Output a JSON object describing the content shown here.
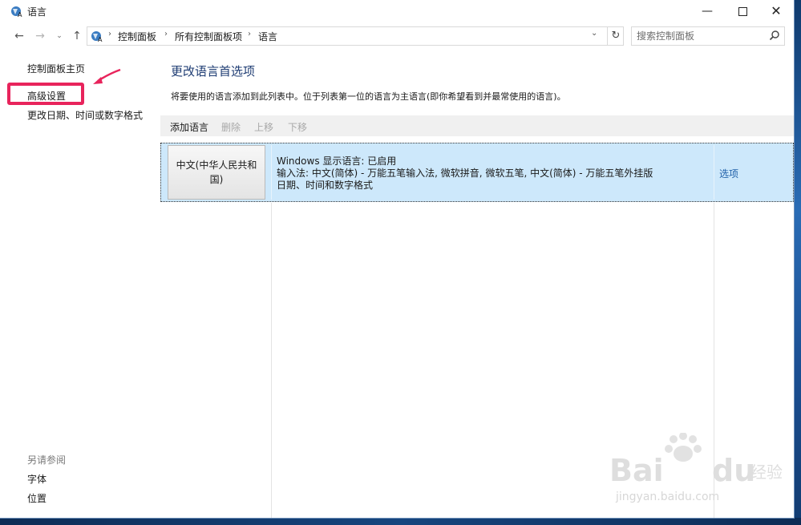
{
  "window": {
    "title": "语言",
    "controls": {
      "minimize": "—",
      "close": "✕"
    }
  },
  "navigation": {
    "back": "←",
    "forward": "→",
    "recent": "⌄",
    "up": "↑",
    "breadcrumbs": [
      "控制面板",
      "所有控制面板项",
      "语言"
    ],
    "separator": "›",
    "dropdown": "⌄",
    "refresh": "↻",
    "search_placeholder": "搜索控制面板"
  },
  "sidebar": {
    "home": "控制面板主页",
    "advanced": "高级设置",
    "datetime": "更改日期、时间或数字格式",
    "see_also_title": "另请参阅",
    "see_also_items": [
      "字体",
      "位置"
    ]
  },
  "main": {
    "title": "更改语言首选项",
    "description": "将要使用的语言添加到此列表中。位于列表第一位的语言为主语言(即你希望看到并最常使用的语言)。",
    "toolbar": {
      "add": "添加语言",
      "remove": "删除",
      "up": "上移",
      "down": "下移"
    },
    "languages": [
      {
        "name": "中文(中华人民共和国)",
        "lines": [
          "Windows 显示语言: 已启用",
          "输入法: 中文(简体) - 万能五笔输入法, 微软拼音, 微软五笔, 中文(简体) - 万能五笔外挂版",
          "日期、时间和数字格式"
        ],
        "options": "选项"
      }
    ]
  },
  "colors": {
    "highlight_box": "#e8245c",
    "selected_row": "#cde8fb",
    "title_text": "#1e3c73",
    "link": "#1e5fa8"
  },
  "watermark": {
    "text": "jingyan.baidu.com"
  }
}
